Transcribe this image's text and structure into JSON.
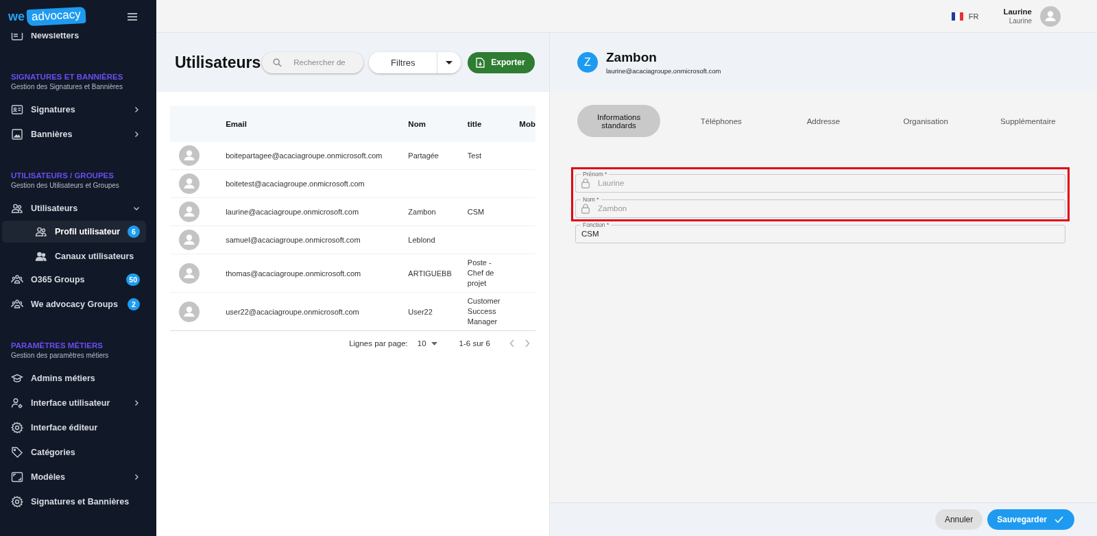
{
  "sidebar": {
    "logo": {
      "first": "we",
      "second": "advocacy"
    },
    "sections": [
      {
        "items": [
          {
            "label": "Newsletters",
            "kind": "link",
            "selected": false
          }
        ]
      },
      {
        "title": "SIGNATURES ET BANNIÈRES",
        "subtitle": "Gestion des Signatures et Bannières",
        "items": [
          {
            "label": "Signatures",
            "kind": "group",
            "expanded": false,
            "selected": false
          },
          {
            "label": "Bannières",
            "kind": "group",
            "expanded": false,
            "selected": false
          }
        ]
      },
      {
        "title": "UTILISATEURS / GROUPES",
        "subtitle": "Gestion des Utilisateurs et Groupes",
        "items": [
          {
            "label": "Utilisateurs",
            "kind": "group",
            "expanded": true,
            "selected": false,
            "children": [
              {
                "label": "Profil utilisateur",
                "selected": true,
                "badge": "6"
              },
              {
                "label": "Canaux utilisateurs",
                "selected": false
              }
            ]
          },
          {
            "label": "O365 Groups",
            "kind": "link",
            "selected": false,
            "badge": "50"
          },
          {
            "label": "We advocacy Groups",
            "kind": "link",
            "selected": false,
            "badge": "2"
          }
        ]
      },
      {
        "title": "PARAMÈTRES MÉTIERS",
        "subtitle": "Gestion des paramètres métiers",
        "items": [
          {
            "label": "Admins métiers",
            "kind": "link",
            "selected": false
          },
          {
            "label": "Interface utilisateur",
            "kind": "group",
            "expanded": false,
            "selected": false
          },
          {
            "label": "Interface éditeur",
            "kind": "link",
            "selected": false
          },
          {
            "label": "Catégories",
            "kind": "link",
            "selected": false
          },
          {
            "label": "Modèles",
            "kind": "group",
            "expanded": false,
            "selected": false
          },
          {
            "label": "Signatures et Bannières",
            "kind": "link",
            "selected": false
          }
        ]
      }
    ]
  },
  "topbar": {
    "language": "FR",
    "user": {
      "name": "Laurine",
      "subtitle": "Laurine"
    }
  },
  "users_panel": {
    "title": "Utilisateurs",
    "search": {
      "placeholder": "Rechercher de"
    },
    "filter_button": "Filtres",
    "export_button": "Exporter",
    "table": {
      "columns": [
        "Email",
        "Nom",
        "title",
        "Mob"
      ],
      "rows": [
        {
          "email": "boitepartagee@acaciagroupe.onmicrosoft.com",
          "nom": "Partagée",
          "title": "Test"
        },
        {
          "email": "boitetest@acaciagroupe.onmicrosoft.com"
        },
        {
          "email": "laurine@acaciagroupe.onmicrosoft.com",
          "nom": "Zambon",
          "title": "CSM"
        },
        {
          "email": "samuel@acaciagroupe.onmicrosoft.com",
          "nom": "Leblond"
        },
        {
          "email": "thomas@acaciagroupe.onmicrosoft.com",
          "nom": "ARTIGUEBB",
          "title": "Poste - Chef de projet"
        },
        {
          "email": "user22@acaciagroupe.onmicrosoft.com",
          "nom": "User22",
          "title": "Customer Success Manager"
        }
      ]
    },
    "pagination": {
      "rows_label": "Lignes par page:",
      "rows_value": "10",
      "range": "1-6 sur 6"
    }
  },
  "profile_panel": {
    "initial": "Z",
    "name": "Zambon",
    "email": "laurine@acaciagroupe.onmicrosoft.com",
    "tabs": [
      {
        "label": "Informations standards",
        "selected": true
      },
      {
        "label": "Téléphones",
        "selected": false
      },
      {
        "label": "Addresse",
        "selected": false
      },
      {
        "label": "Organisation",
        "selected": false
      },
      {
        "label": "Supplémentaire",
        "selected": false
      }
    ],
    "fields": [
      {
        "label": "Prénom *",
        "value": "Laurine",
        "locked": true,
        "highlighted": true
      },
      {
        "label": "Nom *",
        "value": "Zambon",
        "locked": true,
        "highlighted": true
      },
      {
        "label": "Fonction *",
        "value": "CSM",
        "locked": false,
        "highlighted": false
      }
    ],
    "buttons": [
      {
        "label": "Annuler",
        "kind": "secondary"
      },
      {
        "label": "Sauvegarder",
        "kind": "primary"
      }
    ]
  }
}
